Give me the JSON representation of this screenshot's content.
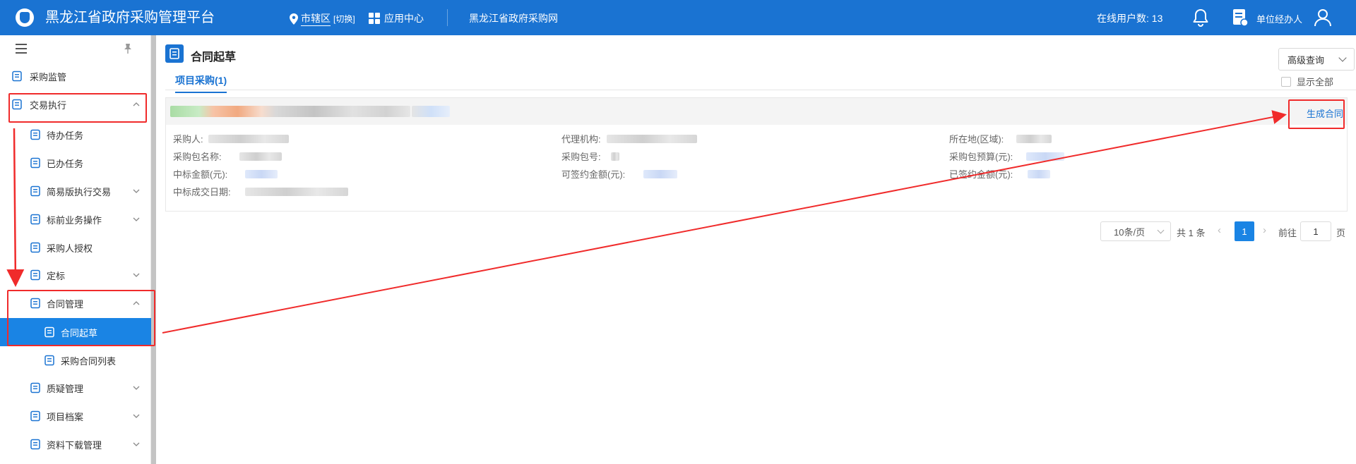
{
  "header": {
    "app_title": "黑龙江省政府采购管理平台",
    "region_label": "市辖区",
    "region_switch": "[切换]",
    "app_center": "应用中心",
    "site_link": "黑龙江省政府采购网",
    "online_users": "在线用户数: 13",
    "user_role": "单位经办人",
    "icons": [
      "logo-icon",
      "location-pin-icon",
      "grid-icon",
      "bell-icon",
      "document-user-icon",
      "person-icon"
    ]
  },
  "sidebar": {
    "items": [
      {
        "label": "采购监管",
        "icon": "shield-check-icon"
      },
      {
        "label": "交易执行",
        "icon": "clipboard-icon",
        "expanded": true
      },
      {
        "label": "待办任务",
        "icon": "task-todo-icon"
      },
      {
        "label": "已办任务",
        "icon": "task-done-icon"
      },
      {
        "label": "简易版执行交易",
        "icon": "percent-circle-icon"
      },
      {
        "label": "标前业务操作",
        "icon": "cart-icon"
      },
      {
        "label": "采购人授权",
        "icon": "shield-user-icon"
      },
      {
        "label": "定标",
        "icon": "edit-square-icon"
      },
      {
        "label": "合同管理",
        "icon": "contract-icon",
        "expanded": true
      },
      {
        "label": "合同起草",
        "icon": "contract-icon",
        "active": true
      },
      {
        "label": "采购合同列表",
        "icon": "list-doc-icon"
      },
      {
        "label": "质疑管理",
        "icon": "cart-icon"
      },
      {
        "label": "项目档案",
        "icon": "user-circle-icon"
      },
      {
        "label": "资料下载管理",
        "icon": "link-icon"
      }
    ]
  },
  "main": {
    "title": "合同起草",
    "advanced_search": "高级查询",
    "tab_label": "项目采购(1)",
    "show_all_label": "显示全部",
    "card": {
      "action_label": "生成合同",
      "fields": {
        "purchaser": "采购人:",
        "agency": "代理机构:",
        "location": "所在地(区域):",
        "package_name": "采购包名称:",
        "package_no": "采购包号:",
        "package_budget": "采购包预算(元):",
        "bid_amount": "中标金额(元):",
        "signable_amount": "可签约金额(元):",
        "signed_amount": "已签约金额(元):",
        "deal_date": "中标成交日期:"
      }
    },
    "pagination": {
      "page_size": "10条/页",
      "total": "共 1 条",
      "current_page": "1",
      "goto_label": "前往",
      "goto_value": "1",
      "page_unit": "页"
    }
  },
  "colors": {
    "brand": "#1a73d2",
    "active": "#1a84e4",
    "highlight": "#f02b2b"
  }
}
